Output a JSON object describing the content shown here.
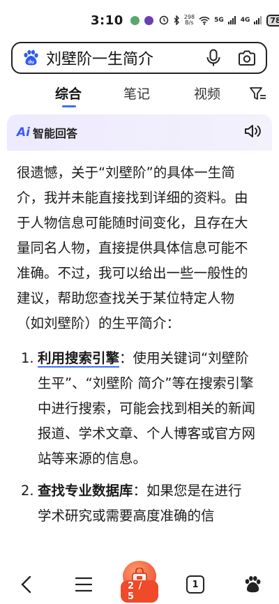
{
  "status_bar": {
    "time": "3:10",
    "net_speed": "298\nB/s",
    "signal_1": "5G",
    "signal_2": "4G",
    "battery": "78"
  },
  "search": {
    "query": "刘壁阶一生简介"
  },
  "tabs": [
    {
      "label": "综合",
      "active": true
    },
    {
      "label": "笔记",
      "active": false
    },
    {
      "label": "视频",
      "active": false
    }
  ],
  "ai_panel": {
    "logo_text": "Ai",
    "title": "智能回答"
  },
  "answer": {
    "intro": "很遗憾，关于“刘壁阶”的具体一生简介，我并未能直接找到详细的资料。由于人物信息可能随时间变化，且存在大量同名人物，直接提供具体信息可能不准确。不过，我可以给出一些一般性的建议，帮助您查找关于某位特定人物（如刘壁阶）的生平简介：",
    "items": [
      {
        "num": "1.",
        "keyword": "利用搜索引擎",
        "text": "：使用关键词“刘壁阶 生平”、“刘壁阶 简介”等在搜索引擎中进行搜索，可能会找到相关的新闻报道、学术文章、个人博客或官方网站等来源的信息。"
      },
      {
        "num": "2.",
        "keyword": "查找专业数据库",
        "text": "：如果您是在进行学术研究或需要高度准确的信"
      }
    ]
  },
  "bottom_nav": {
    "page_indicator": "2 / 5",
    "tab_count": "1"
  },
  "colors": {
    "accent": "#3e6bff",
    "ai_panel_bg": "#eeeaff",
    "page_pill": "#ef4a2a"
  }
}
